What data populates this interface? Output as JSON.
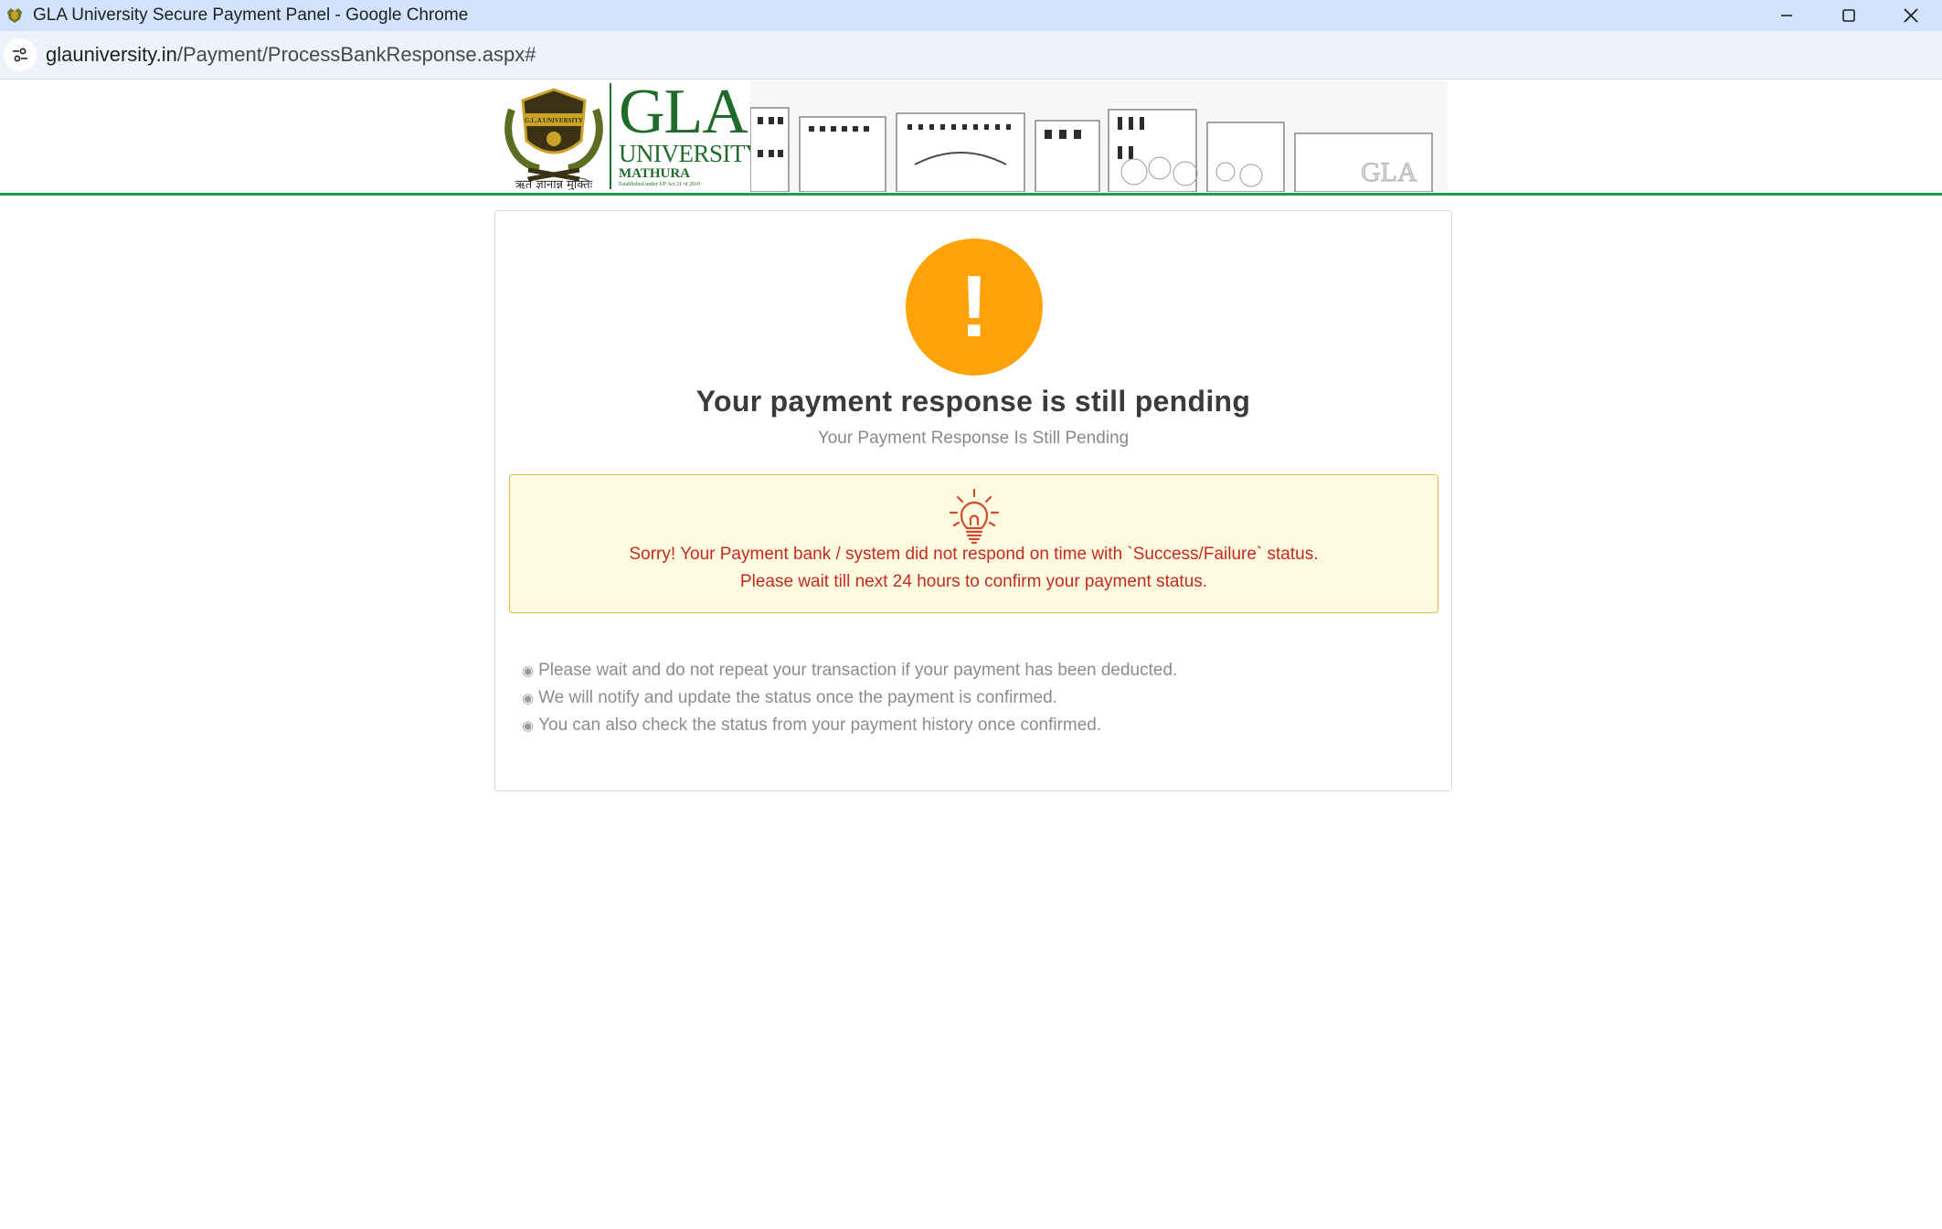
{
  "browser": {
    "window_title": "GLA University Secure Payment Panel - Google Chrome",
    "url_domain": "glauniversity.in",
    "url_path": "/Payment/ProcessBankResponse.aspx#"
  },
  "header": {
    "logo_title": "GLA",
    "logo_subtitle": "UNIVERSITY",
    "logo_city": "MATHURA",
    "logo_established": "Established under UP Act 21 of 2010",
    "emblem_ribbon": "G.L.A UNIVERSITY",
    "motto": "ऋते ज्ञानान्न मुक्तिः",
    "campus_watermark": "GLA"
  },
  "status": {
    "icon_glyph": "!",
    "icon_color": "#fea20a",
    "title": "Your payment response is still pending",
    "subtitle": "Your Payment Response Is Still Pending"
  },
  "alert": {
    "icon": "lightbulb-icon",
    "line1": "Sorry! Your Payment bank / system did not respond on time with `Success/Failure` status.",
    "line2": "Please wait till next 24 hours to confirm your payment status.",
    "text_color": "#c32a22",
    "background": "#fffbe0"
  },
  "notes": [
    "Please wait and do not repeat your transaction if your payment has been deducted.",
    "We will notify and update the status once the payment is confirmed.",
    "You can also check the status from your payment history once confirmed."
  ],
  "notes_bullet": "◉",
  "theme": {
    "brand_green": "#1e6b2a",
    "divider_green": "#1e9a53"
  }
}
